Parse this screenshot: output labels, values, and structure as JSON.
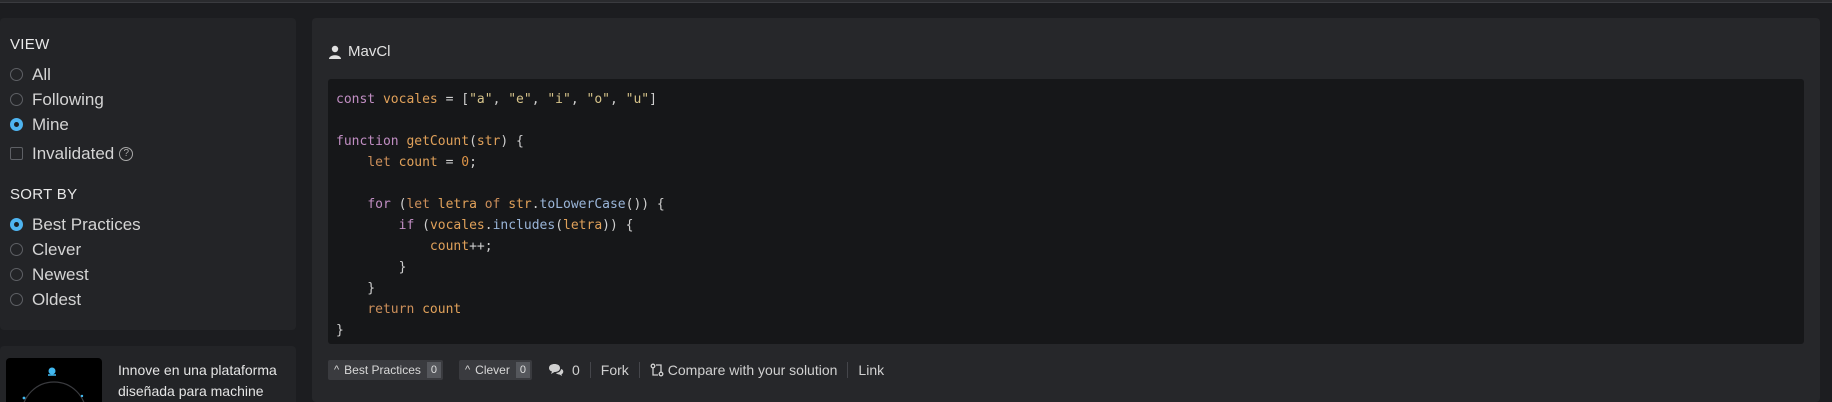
{
  "sidebar": {
    "view": {
      "title": "VIEW",
      "options": [
        {
          "label": "All",
          "selected": false
        },
        {
          "label": "Following",
          "selected": false
        },
        {
          "label": "Mine",
          "selected": true
        }
      ],
      "invalidated_label": "Invalidated",
      "help_glyph": "?"
    },
    "sort": {
      "title": "SORT BY",
      "options": [
        {
          "label": "Best Practices",
          "selected": true
        },
        {
          "label": "Clever",
          "selected": false
        },
        {
          "label": "Newest",
          "selected": false
        },
        {
          "label": "Oldest",
          "selected": false
        }
      ]
    }
  },
  "ad": {
    "text": "Innove en una plataforma diseñada para machine"
  },
  "solution": {
    "author": "MavCl",
    "code_lines": [
      "const vocales = [\"a\", \"e\", \"i\", \"o\", \"u\"]",
      "",
      "function getCount(str) {",
      "    let count = 0;",
      "",
      "    for (let letra of str.toLowerCase()) {",
      "        if (vocales.includes(letra)) {",
      "            count++;",
      "        }",
      "    }",
      "    return count",
      "}"
    ],
    "actions": {
      "best_practices_label": "Best Practices",
      "best_practices_count": "0",
      "clever_label": "Clever",
      "clever_count": "0",
      "comments_count": "0",
      "fork_label": "Fork",
      "compare_label": "Compare with your solution",
      "link_label": "Link"
    }
  },
  "colors": {
    "accent": "#4fb4f0",
    "background": "#1c1d20",
    "panel": "#26272a",
    "code_bg": "#161719"
  }
}
